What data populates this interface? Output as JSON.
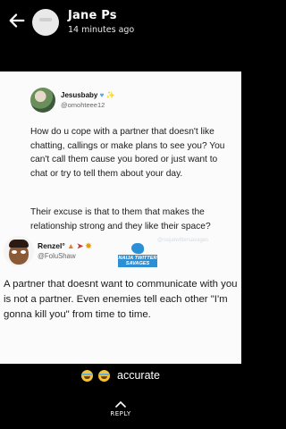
{
  "header": {
    "name": "Jane Ps",
    "time_ago": "14 minutes ago"
  },
  "story": {
    "tweet1": {
      "username": "Jesusbaby",
      "handle": "@omohteee12",
      "paragraph1": "How do u cope with a partner that doesn't like chatting, callings or  make plans to see you? You can't call them cause you bored or just want to chat or try to tell them about your day.",
      "paragraph2": "Their excuse is that to them that makes the relationship strong and they like their space?"
    },
    "watermark": {
      "logo_text": "NAIJA TWITTER SAVAGES",
      "handle": "@naijatwittersavages"
    },
    "tweet2": {
      "username": "Renzel°",
      "handle": "@FoluShaw",
      "text": "A partner that doesnt want to communicate with you is not a partner. Even enemies tell each other \"I'm gonna kill you\" from time to time."
    }
  },
  "caption": {
    "text": "accurate",
    "emoji": "joy-face"
  },
  "reply": {
    "label": "REPLY"
  },
  "colors": {
    "background": "#000000",
    "card": "#fbfbfb",
    "verified_blue": "#49a8e8",
    "watermark_blue": "#2c8fd6"
  }
}
